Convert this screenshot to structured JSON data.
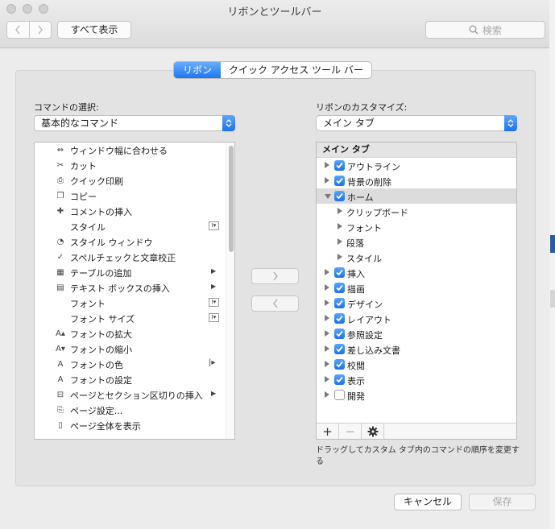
{
  "window": {
    "title": "リボンとツールバー"
  },
  "toolbar": {
    "show_all": "すべて表示",
    "search_placeholder": "検索"
  },
  "tabs": [
    {
      "label": "リボン",
      "active": true
    },
    {
      "label": "クイック アクセス ツール バー",
      "active": false
    }
  ],
  "left": {
    "label": "コマンドの選択:",
    "dropdown": "基本的なコマンド",
    "commands": [
      {
        "label": "ウィンドウ幅に合わせる",
        "icon": "fit-width-icon"
      },
      {
        "label": "カット",
        "icon": "scissors-icon"
      },
      {
        "label": "クイック印刷",
        "icon": "printer-icon"
      },
      {
        "label": "コピー",
        "icon": "copy-icon"
      },
      {
        "label": "コメントの挿入",
        "icon": "comment-add-icon"
      },
      {
        "label": "スタイル",
        "icon": "",
        "ind": "combo"
      },
      {
        "label": "スタイル ウィンドウ",
        "icon": "style-window-icon"
      },
      {
        "label": "スペルチェックと文章校正",
        "icon": "spellcheck-icon"
      },
      {
        "label": "テーブルの追加",
        "icon": "table-icon",
        "ind": "sub"
      },
      {
        "label": "テキスト ボックスの挿入",
        "icon": "textbox-icon",
        "ind": "sub"
      },
      {
        "label": "フォント",
        "icon": "",
        "ind": "combo"
      },
      {
        "label": "フォント サイズ",
        "icon": "",
        "ind": "combo"
      },
      {
        "label": "フォントの拡大",
        "icon": "font-grow-icon"
      },
      {
        "label": "フォントの縮小",
        "icon": "font-shrink-icon"
      },
      {
        "label": "フォントの色",
        "icon": "font-color-icon",
        "ind": "bar"
      },
      {
        "label": "フォントの設定",
        "icon": "font-settings-icon"
      },
      {
        "label": "ページとセクション区切りの挿入",
        "icon": "page-break-icon",
        "ind": "sub"
      },
      {
        "label": "ページ設定...",
        "icon": "page-setup-icon"
      },
      {
        "label": "ページ全体を表示",
        "icon": "page-view-icon"
      },
      {
        "label": "",
        "icon": "more-icon"
      }
    ]
  },
  "right": {
    "label": "リボンのカスタマイズ:",
    "dropdown": "メイン タブ",
    "tree_header": "メイン タブ",
    "tree": [
      {
        "label": "アウトライン",
        "level": 0,
        "checked": true,
        "open": false
      },
      {
        "label": "背景の削除",
        "level": 0,
        "checked": true,
        "open": false
      },
      {
        "label": "ホーム",
        "level": 0,
        "checked": true,
        "open": true,
        "selected": true
      },
      {
        "label": "クリップボード",
        "level": 1
      },
      {
        "label": "フォント",
        "level": 1
      },
      {
        "label": "段落",
        "level": 1
      },
      {
        "label": "スタイル",
        "level": 1
      },
      {
        "label": "挿入",
        "level": 0,
        "checked": true,
        "open": false
      },
      {
        "label": "描画",
        "level": 0,
        "checked": true,
        "open": false
      },
      {
        "label": "デザイン",
        "level": 0,
        "checked": true,
        "open": false
      },
      {
        "label": "レイアウト",
        "level": 0,
        "checked": true,
        "open": false
      },
      {
        "label": "参照設定",
        "level": 0,
        "checked": true,
        "open": false
      },
      {
        "label": "差し込み文書",
        "level": 0,
        "checked": true,
        "open": false
      },
      {
        "label": "校閲",
        "level": 0,
        "checked": true,
        "open": false
      },
      {
        "label": "表示",
        "level": 0,
        "checked": true,
        "open": false
      },
      {
        "label": "開発",
        "level": 0,
        "checked": false,
        "open": false
      }
    ],
    "tools": {
      "add": "+",
      "remove": "−"
    },
    "hint": "ドラッグしてカスタム タブ内のコマンドの順序を変更する"
  },
  "buttons": {
    "cancel": "キャンセル",
    "save": "保存"
  },
  "colors": {
    "accent": "#1b72ef",
    "panel": "#e3e3e3",
    "window": "#ececec"
  }
}
